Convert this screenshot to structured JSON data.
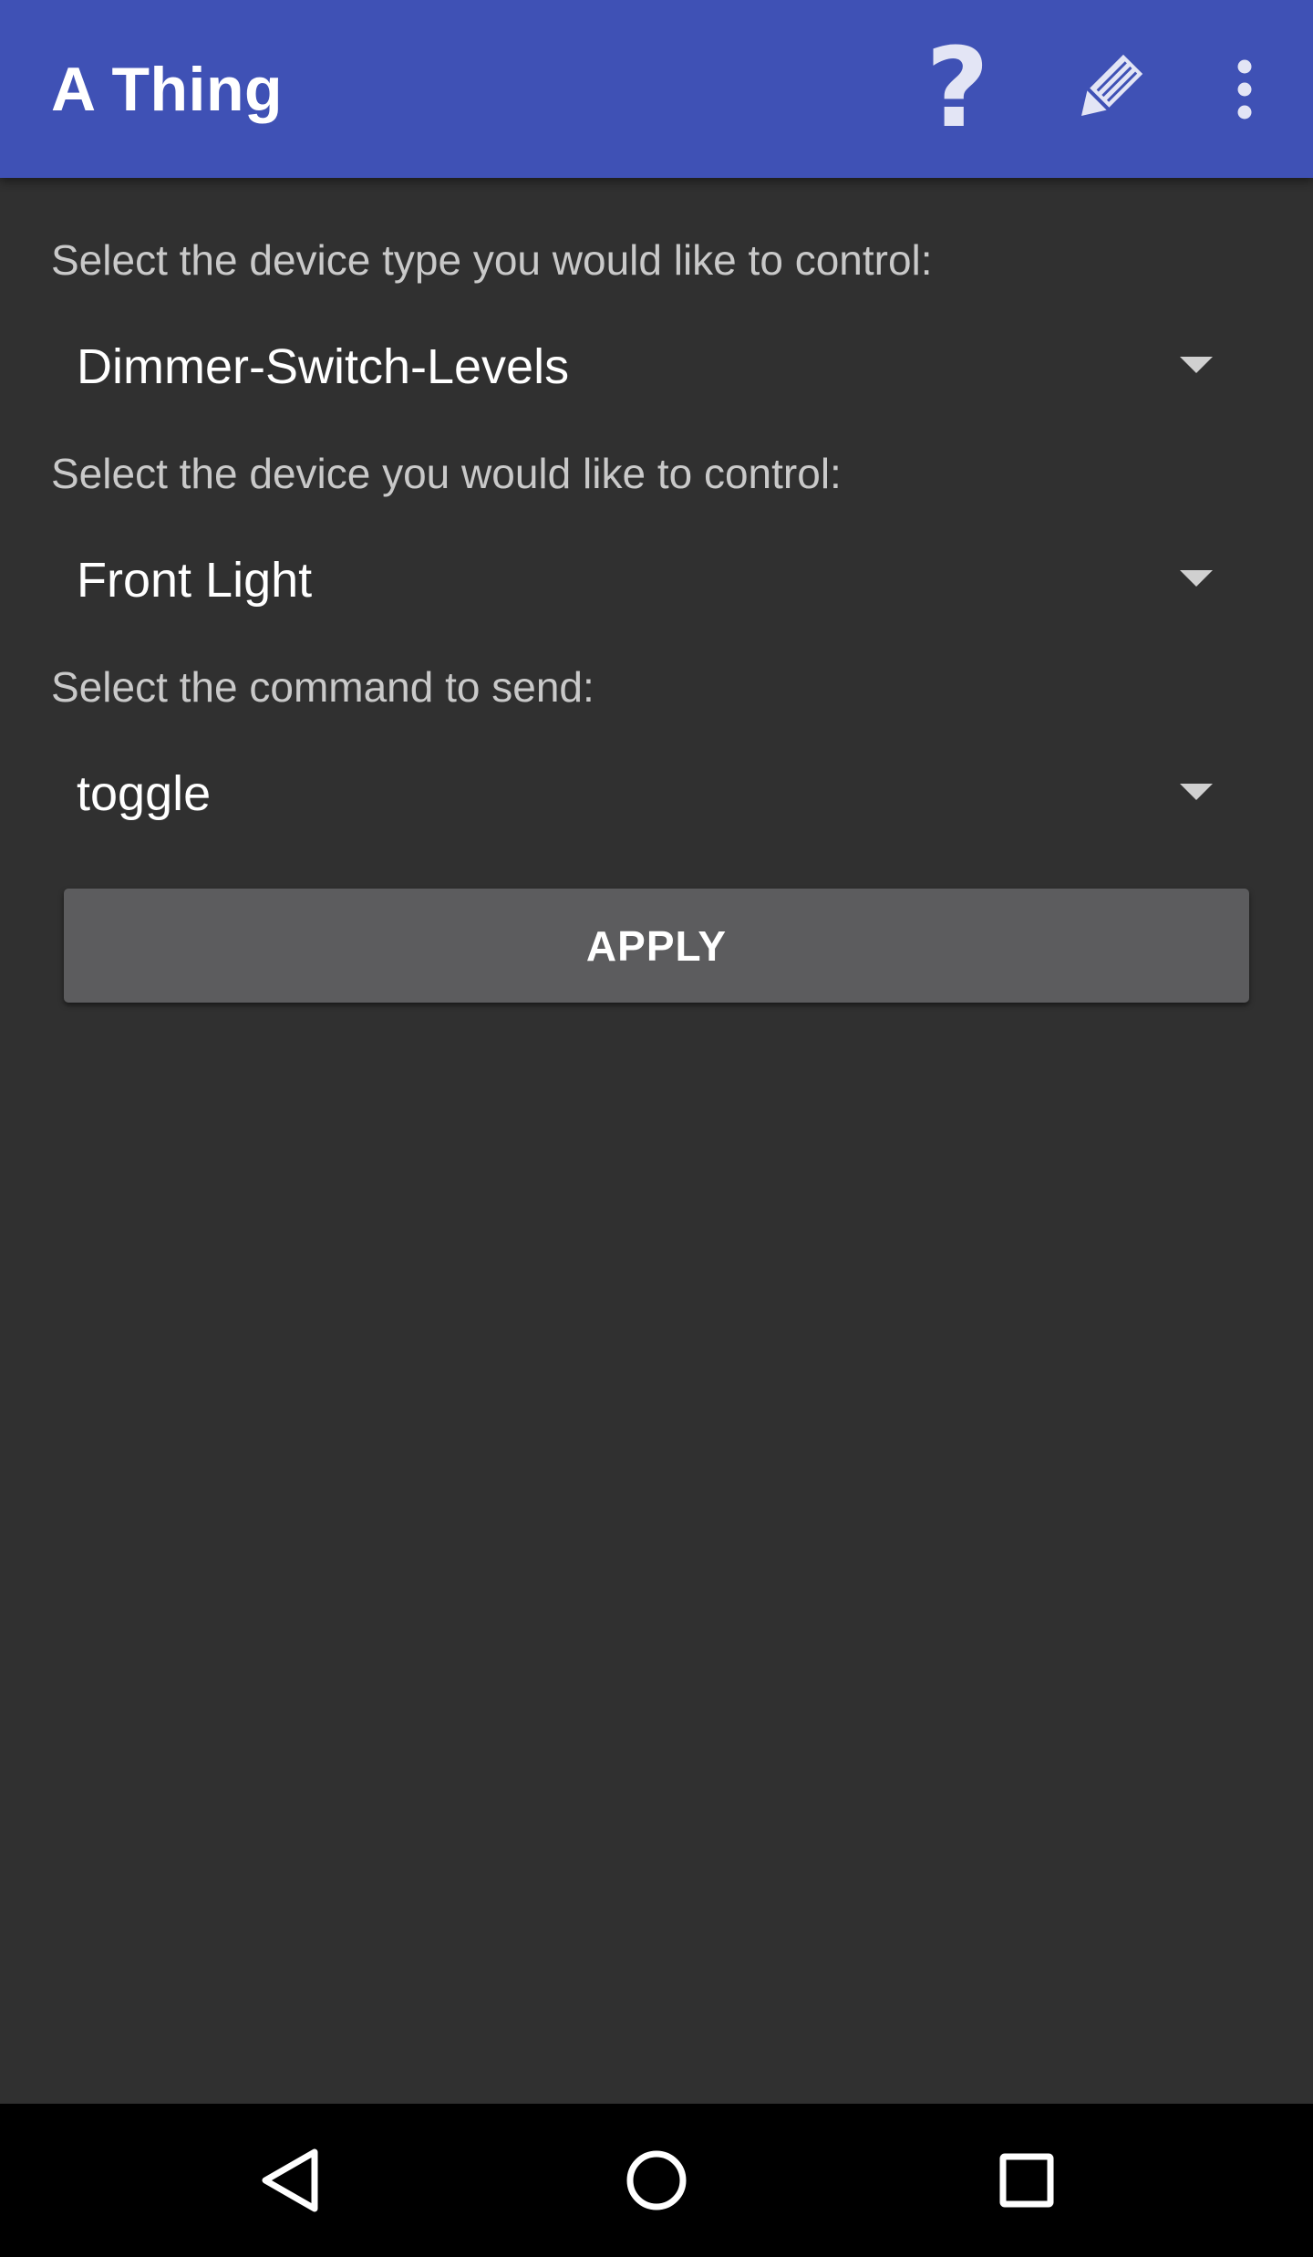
{
  "app_bar": {
    "title": "A Thing",
    "color": "#3F51B5",
    "actions": [
      {
        "name": "help",
        "icon": "help-icon",
        "glyph": "?"
      },
      {
        "name": "edit",
        "icon": "pencil-icon"
      },
      {
        "name": "overflow",
        "icon": "more-vert-icon"
      }
    ]
  },
  "form": {
    "device_type": {
      "label": "Select the device type you would like to control:",
      "selected": "Dimmer-Switch-Levels"
    },
    "device": {
      "label": "Select the device you would like to control:",
      "selected": "Front Light"
    },
    "command": {
      "label": "Select the command to send:",
      "selected": "toggle"
    },
    "apply_label": "APPLY"
  },
  "nav_bar": {
    "buttons": [
      "back-icon",
      "home-icon",
      "recents-icon"
    ]
  },
  "colors": {
    "background": "#303030",
    "button": "#5C5C5E",
    "label_text": "#C9C9C9",
    "value_text": "#FFFFFF"
  }
}
